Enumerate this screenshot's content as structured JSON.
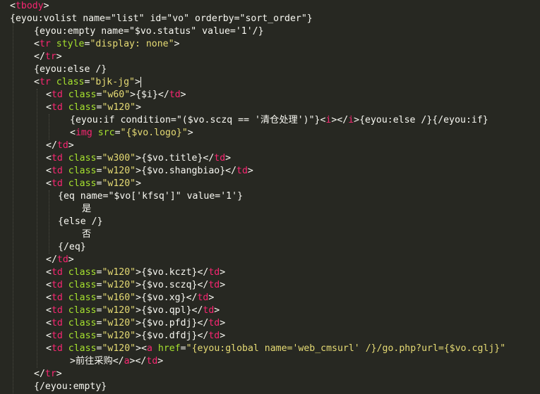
{
  "editor": {
    "colors": {
      "background": "#272822",
      "tag": "#f92672",
      "attribute": "#a6e22e",
      "string": "#e6db74",
      "text": "#f8f8f2"
    },
    "lines": [
      [
        [
          "p",
          "<"
        ],
        [
          "t",
          "tbody"
        ],
        [
          "p",
          ">"
        ]
      ],
      [
        [
          "x",
          "{eyou:volist name=\"list\" id=\"vo\" orderby=\"sort_order\"}"
        ]
      ],
      [
        [
          "x",
          "{eyou:empty name=\"$vo.status\" value='1'/}"
        ]
      ],
      [
        [
          "p",
          "<"
        ],
        [
          "t",
          "tr"
        ],
        [
          "x",
          " "
        ],
        [
          "a",
          "style"
        ],
        [
          "p",
          "="
        ],
        [
          "s",
          "\"display: none\""
        ],
        [
          "p",
          ">"
        ]
      ],
      [
        [
          "p",
          "</"
        ],
        [
          "t",
          "tr"
        ],
        [
          "p",
          ">"
        ]
      ],
      [
        [
          "x",
          "{eyou:else /}"
        ]
      ],
      [
        [
          "p",
          "<"
        ],
        [
          "t",
          "tr"
        ],
        [
          "x",
          " "
        ],
        [
          "a",
          "class"
        ],
        [
          "p",
          "="
        ],
        [
          "s",
          "\"bjk-jg\""
        ],
        [
          "p",
          ">"
        ]
      ],
      [
        [
          "p",
          "<"
        ],
        [
          "t",
          "td"
        ],
        [
          "x",
          " "
        ],
        [
          "a",
          "class"
        ],
        [
          "p",
          "="
        ],
        [
          "s",
          "\"w60\""
        ],
        [
          "p",
          ">"
        ],
        [
          "x",
          "{$i}"
        ],
        [
          "p",
          "</"
        ],
        [
          "t",
          "td"
        ],
        [
          "p",
          ">"
        ]
      ],
      [
        [
          "p",
          "<"
        ],
        [
          "t",
          "td"
        ],
        [
          "x",
          " "
        ],
        [
          "a",
          "class"
        ],
        [
          "p",
          "="
        ],
        [
          "s",
          "\"w120\""
        ],
        [
          "p",
          ">"
        ]
      ],
      [
        [
          "x",
          "{eyou:if condition=\"($vo.sczq == '清仓处理')\"}"
        ],
        [
          "p",
          "<"
        ],
        [
          "t",
          "i"
        ],
        [
          "p",
          "></"
        ],
        [
          "t",
          "i"
        ],
        [
          "p",
          ">"
        ],
        [
          "x",
          "{eyou:else /}{/eyou:if}"
        ]
      ],
      [
        [
          "p",
          "<"
        ],
        [
          "t",
          "img"
        ],
        [
          "x",
          " "
        ],
        [
          "a",
          "src"
        ],
        [
          "p",
          "="
        ],
        [
          "s",
          "\"{$vo.logo}\""
        ],
        [
          "p",
          ">"
        ]
      ],
      [
        [
          "p",
          "</"
        ],
        [
          "t",
          "td"
        ],
        [
          "p",
          ">"
        ]
      ],
      [
        [
          "p",
          "<"
        ],
        [
          "t",
          "td"
        ],
        [
          "x",
          " "
        ],
        [
          "a",
          "class"
        ],
        [
          "p",
          "="
        ],
        [
          "s",
          "\"w300\""
        ],
        [
          "p",
          ">"
        ],
        [
          "x",
          "{$vo.title}"
        ],
        [
          "p",
          "</"
        ],
        [
          "t",
          "td"
        ],
        [
          "p",
          ">"
        ]
      ],
      [
        [
          "p",
          "<"
        ],
        [
          "t",
          "td"
        ],
        [
          "x",
          " "
        ],
        [
          "a",
          "class"
        ],
        [
          "p",
          "="
        ],
        [
          "s",
          "\"w120\""
        ],
        [
          "p",
          ">"
        ],
        [
          "x",
          "{$vo.shangbiao}"
        ],
        [
          "p",
          "</"
        ],
        [
          "t",
          "td"
        ],
        [
          "p",
          ">"
        ]
      ],
      [
        [
          "p",
          "<"
        ],
        [
          "t",
          "td"
        ],
        [
          "x",
          " "
        ],
        [
          "a",
          "class"
        ],
        [
          "p",
          "="
        ],
        [
          "s",
          "\"w120\""
        ],
        [
          "p",
          ">"
        ]
      ],
      [
        [
          "x",
          "{eq name=\"$vo['kfsq']\" value='1'}"
        ]
      ],
      [
        [
          "x",
          "是"
        ]
      ],
      [
        [
          "x",
          "{else /}"
        ]
      ],
      [
        [
          "x",
          "否"
        ]
      ],
      [
        [
          "x",
          "{/eq}"
        ]
      ],
      [
        [
          "p",
          "</"
        ],
        [
          "t",
          "td"
        ],
        [
          "p",
          ">"
        ]
      ],
      [
        [
          "p",
          "<"
        ],
        [
          "t",
          "td"
        ],
        [
          "x",
          " "
        ],
        [
          "a",
          "class"
        ],
        [
          "p",
          "="
        ],
        [
          "s",
          "\"w120\""
        ],
        [
          "p",
          ">"
        ],
        [
          "x",
          "{$vo.kczt}"
        ],
        [
          "p",
          "</"
        ],
        [
          "t",
          "td"
        ],
        [
          "p",
          ">"
        ]
      ],
      [
        [
          "p",
          "<"
        ],
        [
          "t",
          "td"
        ],
        [
          "x",
          " "
        ],
        [
          "a",
          "class"
        ],
        [
          "p",
          "="
        ],
        [
          "s",
          "\"w120\""
        ],
        [
          "p",
          ">"
        ],
        [
          "x",
          "{$vo.sczq}"
        ],
        [
          "p",
          "</"
        ],
        [
          "t",
          "td"
        ],
        [
          "p",
          ">"
        ]
      ],
      [
        [
          "p",
          "<"
        ],
        [
          "t",
          "td"
        ],
        [
          "x",
          " "
        ],
        [
          "a",
          "class"
        ],
        [
          "p",
          "="
        ],
        [
          "s",
          "\"w160\""
        ],
        [
          "p",
          ">"
        ],
        [
          "x",
          "{$vo.xg}"
        ],
        [
          "p",
          "</"
        ],
        [
          "t",
          "td"
        ],
        [
          "p",
          ">"
        ]
      ],
      [
        [
          "p",
          "<"
        ],
        [
          "t",
          "td"
        ],
        [
          "x",
          " "
        ],
        [
          "a",
          "class"
        ],
        [
          "p",
          "="
        ],
        [
          "s",
          "\"w120\""
        ],
        [
          "p",
          ">"
        ],
        [
          "x",
          "{$vo.qpl}"
        ],
        [
          "p",
          "</"
        ],
        [
          "t",
          "td"
        ],
        [
          "p",
          ">"
        ]
      ],
      [
        [
          "p",
          "<"
        ],
        [
          "t",
          "td"
        ],
        [
          "x",
          " "
        ],
        [
          "a",
          "class"
        ],
        [
          "p",
          "="
        ],
        [
          "s",
          "\"w120\""
        ],
        [
          "p",
          ">"
        ],
        [
          "x",
          "{$vo.pfdj}"
        ],
        [
          "p",
          "</"
        ],
        [
          "t",
          "td"
        ],
        [
          "p",
          ">"
        ]
      ],
      [
        [
          "p",
          "<"
        ],
        [
          "t",
          "td"
        ],
        [
          "x",
          " "
        ],
        [
          "a",
          "class"
        ],
        [
          "p",
          "="
        ],
        [
          "s",
          "\"w120\""
        ],
        [
          "p",
          ">"
        ],
        [
          "x",
          "{$vo.dfdj}"
        ],
        [
          "p",
          "</"
        ],
        [
          "t",
          "td"
        ],
        [
          "p",
          ">"
        ]
      ],
      [
        [
          "p",
          "<"
        ],
        [
          "t",
          "td"
        ],
        [
          "x",
          " "
        ],
        [
          "a",
          "class"
        ],
        [
          "p",
          "="
        ],
        [
          "s",
          "\"w120\""
        ],
        [
          "p",
          ">"
        ],
        [
          "p",
          "<"
        ],
        [
          "t",
          "a"
        ],
        [
          "x",
          " "
        ],
        [
          "a",
          "href"
        ],
        [
          "p",
          "="
        ],
        [
          "s",
          "\"{eyou:global name='web_cmsurl' /}/go.php?url={$vo.cglj}\""
        ]
      ],
      [
        [
          "p",
          ">"
        ],
        [
          "x",
          "前往采购"
        ],
        [
          "p",
          "</"
        ],
        [
          "t",
          "a"
        ],
        [
          "p",
          "></"
        ],
        [
          "t",
          "td"
        ],
        [
          "p",
          ">"
        ]
      ],
      [
        [
          "p",
          "</"
        ],
        [
          "t",
          "tr"
        ],
        [
          "p",
          ">"
        ]
      ],
      [
        [
          "x",
          "{/eyou:empty}"
        ]
      ]
    ]
  }
}
